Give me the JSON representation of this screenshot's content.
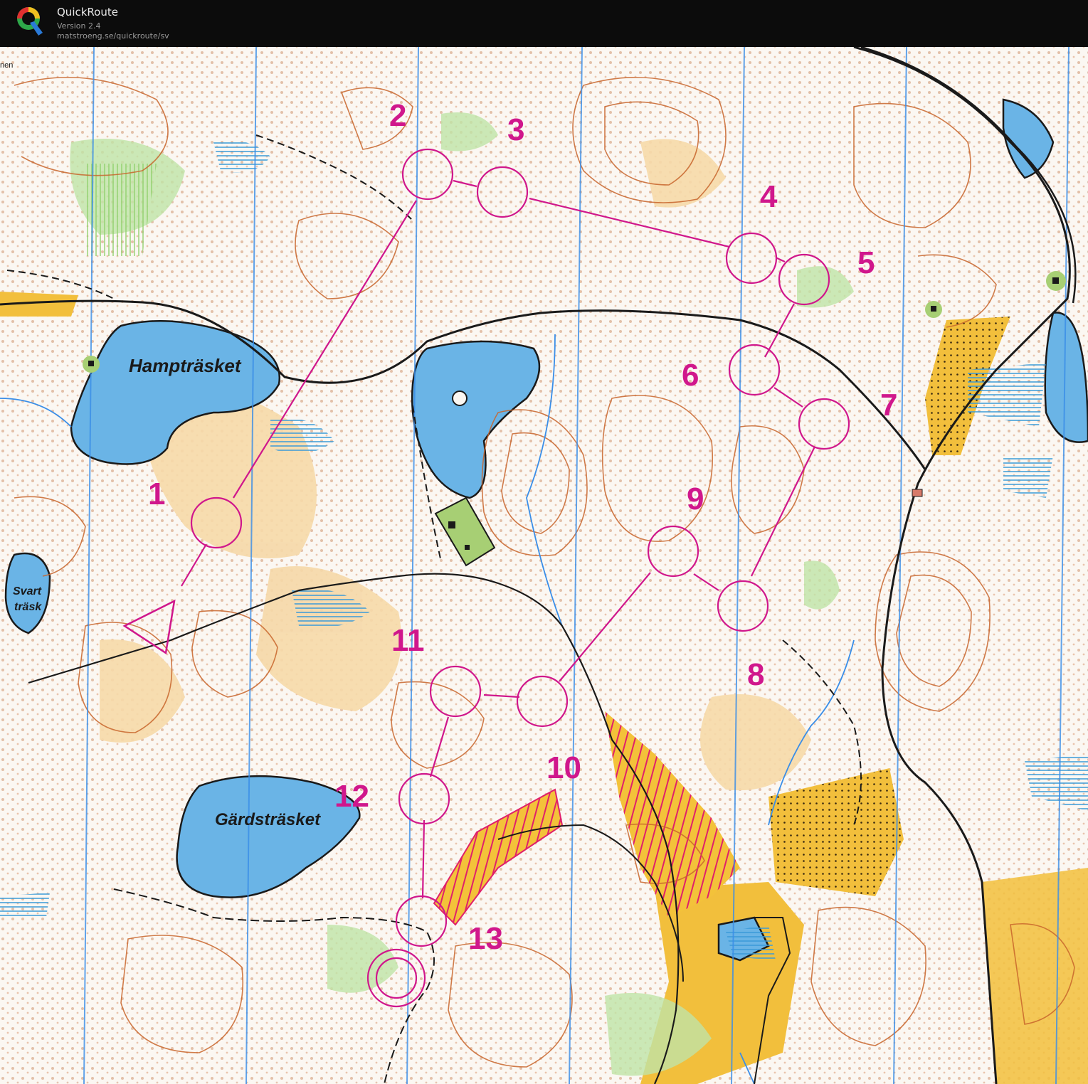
{
  "app": {
    "title": "QuickRoute",
    "version": "Version 2.4",
    "url": "matstroeng.se/quickroute/sv",
    "logo_letter": "Q"
  },
  "map": {
    "lakes": [
      "Hampträsket",
      "Gärdsträsket"
    ],
    "svart_trask": [
      "Svart",
      "träsk"
    ],
    "controls": [
      "1",
      "2",
      "3",
      "4",
      "5",
      "6",
      "7",
      "8",
      "9",
      "10",
      "11",
      "12",
      "13"
    ],
    "edge_text": "nen"
  },
  "colors": {
    "header_bg": "#0c0c0c",
    "paper": "#fbf7f2",
    "water": "#6ab4e6",
    "contour": "#c8652c",
    "course": "#d0178c",
    "open_land": "#f1b13a",
    "vegetation": "#7bbf6a",
    "north_lines": "#3a8ee8",
    "road": "#1a1a1a"
  }
}
